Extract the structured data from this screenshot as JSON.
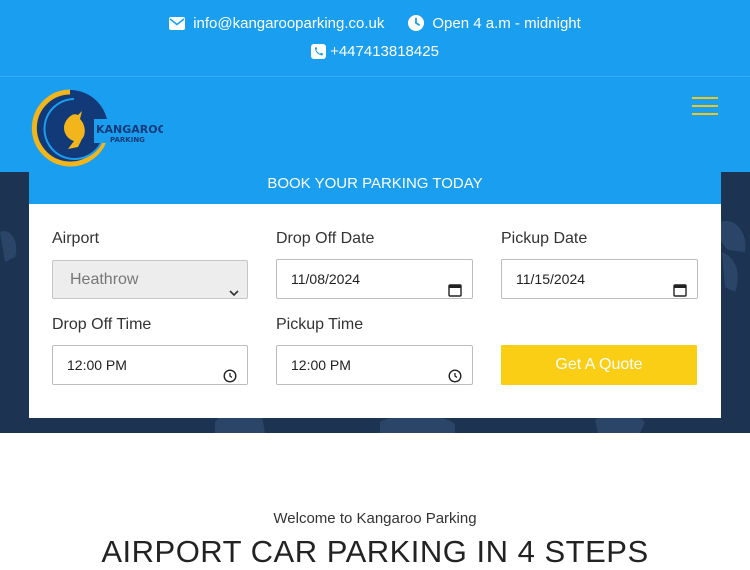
{
  "topbar": {
    "email": "info@kangarooparking.co.uk",
    "hours": "Open 4 a.m - midnight",
    "phone": "+447413818425"
  },
  "logo": {
    "text_main": "KANGAROO",
    "text_sub": "PARKING"
  },
  "booking": {
    "heading": "BOOK YOUR PARKING TODAY",
    "airport_label": "Airport",
    "airport_value": "Heathrow",
    "dropoff_date_label": "Drop Off Date",
    "dropoff_date_value": "11/08/2024",
    "pickup_date_label": "Pickup Date",
    "pickup_date_value": "11/15/2024",
    "dropoff_time_label": "Drop Off Time",
    "dropoff_time_value": "12:00 PM",
    "pickup_time_label": "Pickup Time",
    "pickup_time_value": "12:00 PM",
    "quote_button": "Get A Quote"
  },
  "intro": {
    "welcome": "Welcome to Kangaroo Parking",
    "title": "AIRPORT CAR PARKING IN 4 STEPS"
  },
  "colors": {
    "primary_blue": "#1a9ff0",
    "accent_yellow": "#fbce16",
    "hero_navy": "#1c3351"
  },
  "icons": [
    "envelope-icon",
    "clock-icon",
    "phone-icon",
    "hamburger-icon",
    "calendar-icon",
    "clock-icon",
    "chevron-down-icon"
  ]
}
